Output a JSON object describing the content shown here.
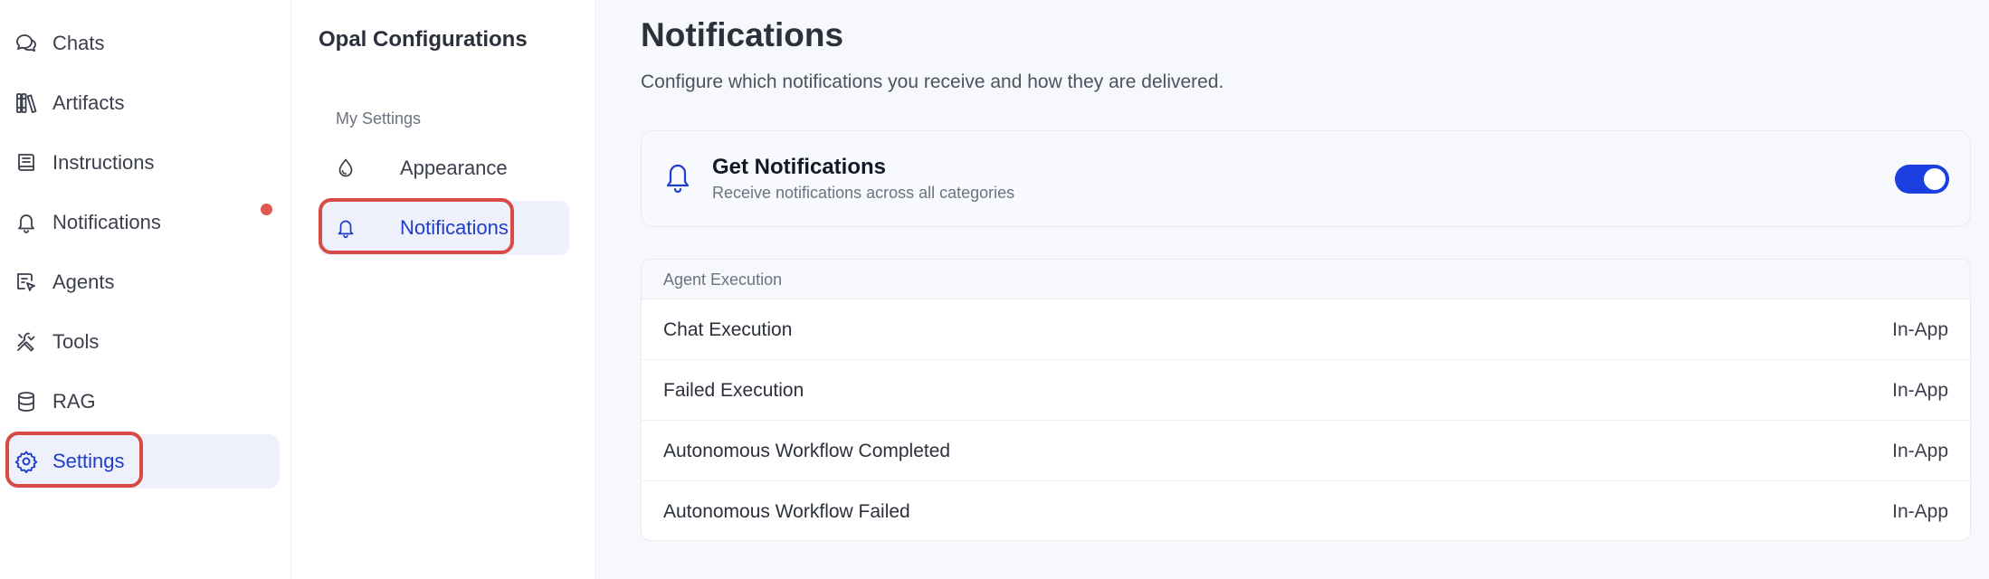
{
  "nav": {
    "items": [
      {
        "label": "Chats",
        "icon": "chats-icon"
      },
      {
        "label": "Artifacts",
        "icon": "artifacts-icon"
      },
      {
        "label": "Instructions",
        "icon": "instructions-icon"
      },
      {
        "label": "Notifications",
        "icon": "bell-icon"
      },
      {
        "label": "Agents",
        "icon": "agents-icon"
      },
      {
        "label": "Tools",
        "icon": "tools-icon"
      },
      {
        "label": "RAG",
        "icon": "database-icon"
      },
      {
        "label": "Settings",
        "icon": "gear-icon"
      }
    ],
    "active": "Settings"
  },
  "settings_menu": {
    "title": "Opal Configurations",
    "section": "My Settings",
    "items": [
      {
        "label": "Appearance",
        "icon": "droplet-icon"
      },
      {
        "label": "Notifications",
        "icon": "bell-icon"
      }
    ],
    "active": "Notifications"
  },
  "page": {
    "title": "Notifications",
    "subtitle": "Configure which notifications you receive and how they are delivered."
  },
  "master": {
    "title": "Get Notifications",
    "description": "Receive notifications across all categories",
    "enabled": true
  },
  "table": {
    "group": "Agent Execution",
    "rows": [
      {
        "name": "Chat Execution",
        "channel": "In-App"
      },
      {
        "name": "Failed Execution",
        "channel": "In-App"
      },
      {
        "name": "Autonomous Workflow Completed",
        "channel": "In-App"
      },
      {
        "name": "Autonomous Workflow Failed",
        "channel": "In-App"
      }
    ]
  },
  "colors": {
    "accent": "#1b3ee0",
    "active_bg": "#eef0fb",
    "highlight": "#d84a44",
    "badge": "#e05753"
  }
}
